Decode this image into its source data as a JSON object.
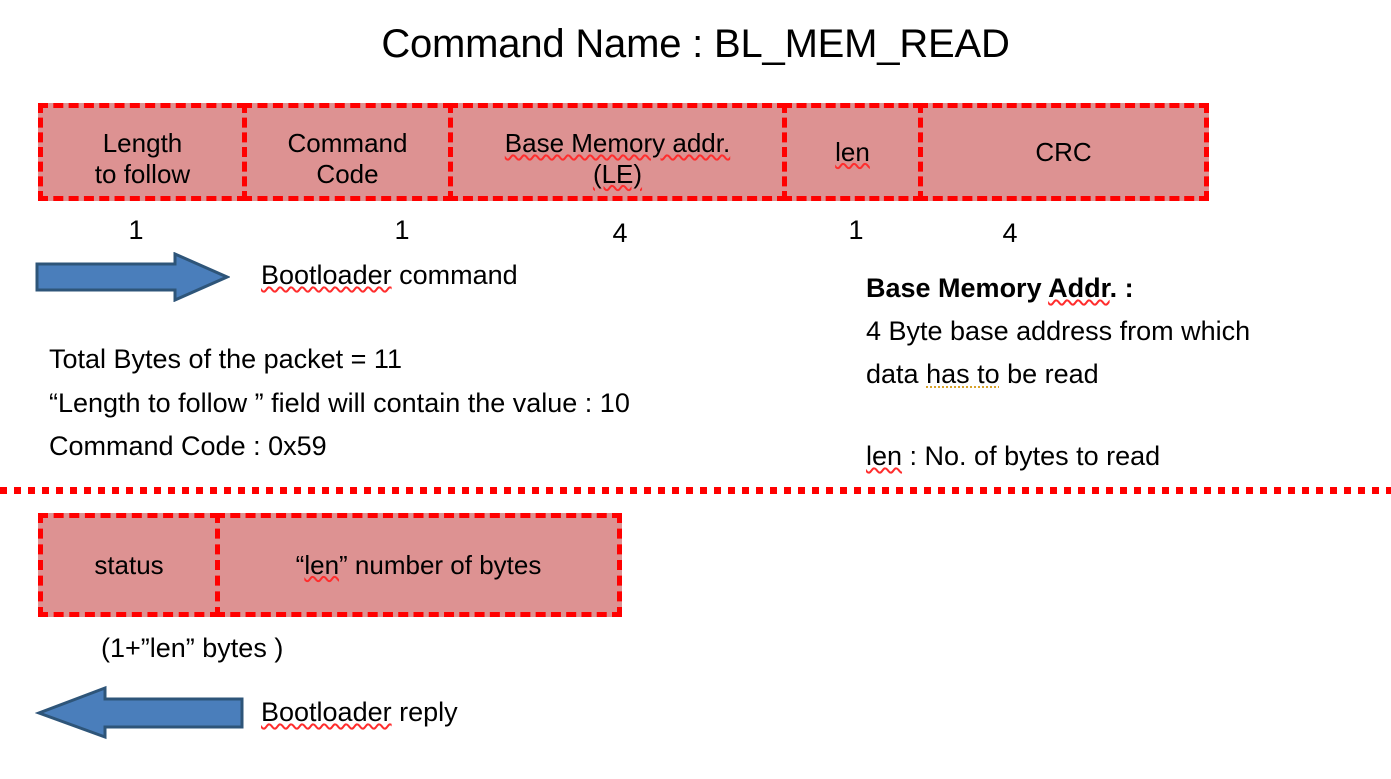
{
  "title": "Command Name : BL_MEM_READ",
  "command_packet": {
    "fields": [
      {
        "label": "Length\nto follow",
        "bytes": "1"
      },
      {
        "label": "Command\nCode",
        "bytes": "1"
      },
      {
        "label": "Base Memory addr.\n(LE)",
        "bytes": "4"
      },
      {
        "label": "len",
        "bytes": "1"
      },
      {
        "label": "CRC",
        "bytes": "4"
      }
    ],
    "arrow_label": "Bootloader command",
    "arrow_direction": "right"
  },
  "notes_left": {
    "total_bytes": "Total Bytes of the packet = 11",
    "length_to_follow_quoted": "“Length to follow ”",
    "length_to_follow_rest": " field will contain the value : 10",
    "command_code_label": "Command Code",
    "command_code_value": " : 0x59"
  },
  "notes_right": {
    "base_addr_heading": "Base Memory Addr. :",
    "base_addr_line1_a": "4 Byte base address from which",
    "base_addr_line2_a": "data ",
    "base_addr_line2_gr": "has to",
    "base_addr_line2_b": " be read",
    "len_label": "len",
    "len_desc": " : No. of bytes to read"
  },
  "reply_packet": {
    "fields": [
      {
        "label": "status"
      },
      {
        "label": "“len” number of bytes"
      }
    ],
    "size_note": "(1+”len” bytes )",
    "arrow_label": "Bootloader reply",
    "arrow_direction": "left"
  },
  "colors": {
    "field_fill": "#dd9292",
    "field_border": "#ff0000",
    "arrow_fill": "#4a7ebb",
    "arrow_stroke": "#2e5579",
    "divider": "#ff0000",
    "text": "#000000"
  }
}
